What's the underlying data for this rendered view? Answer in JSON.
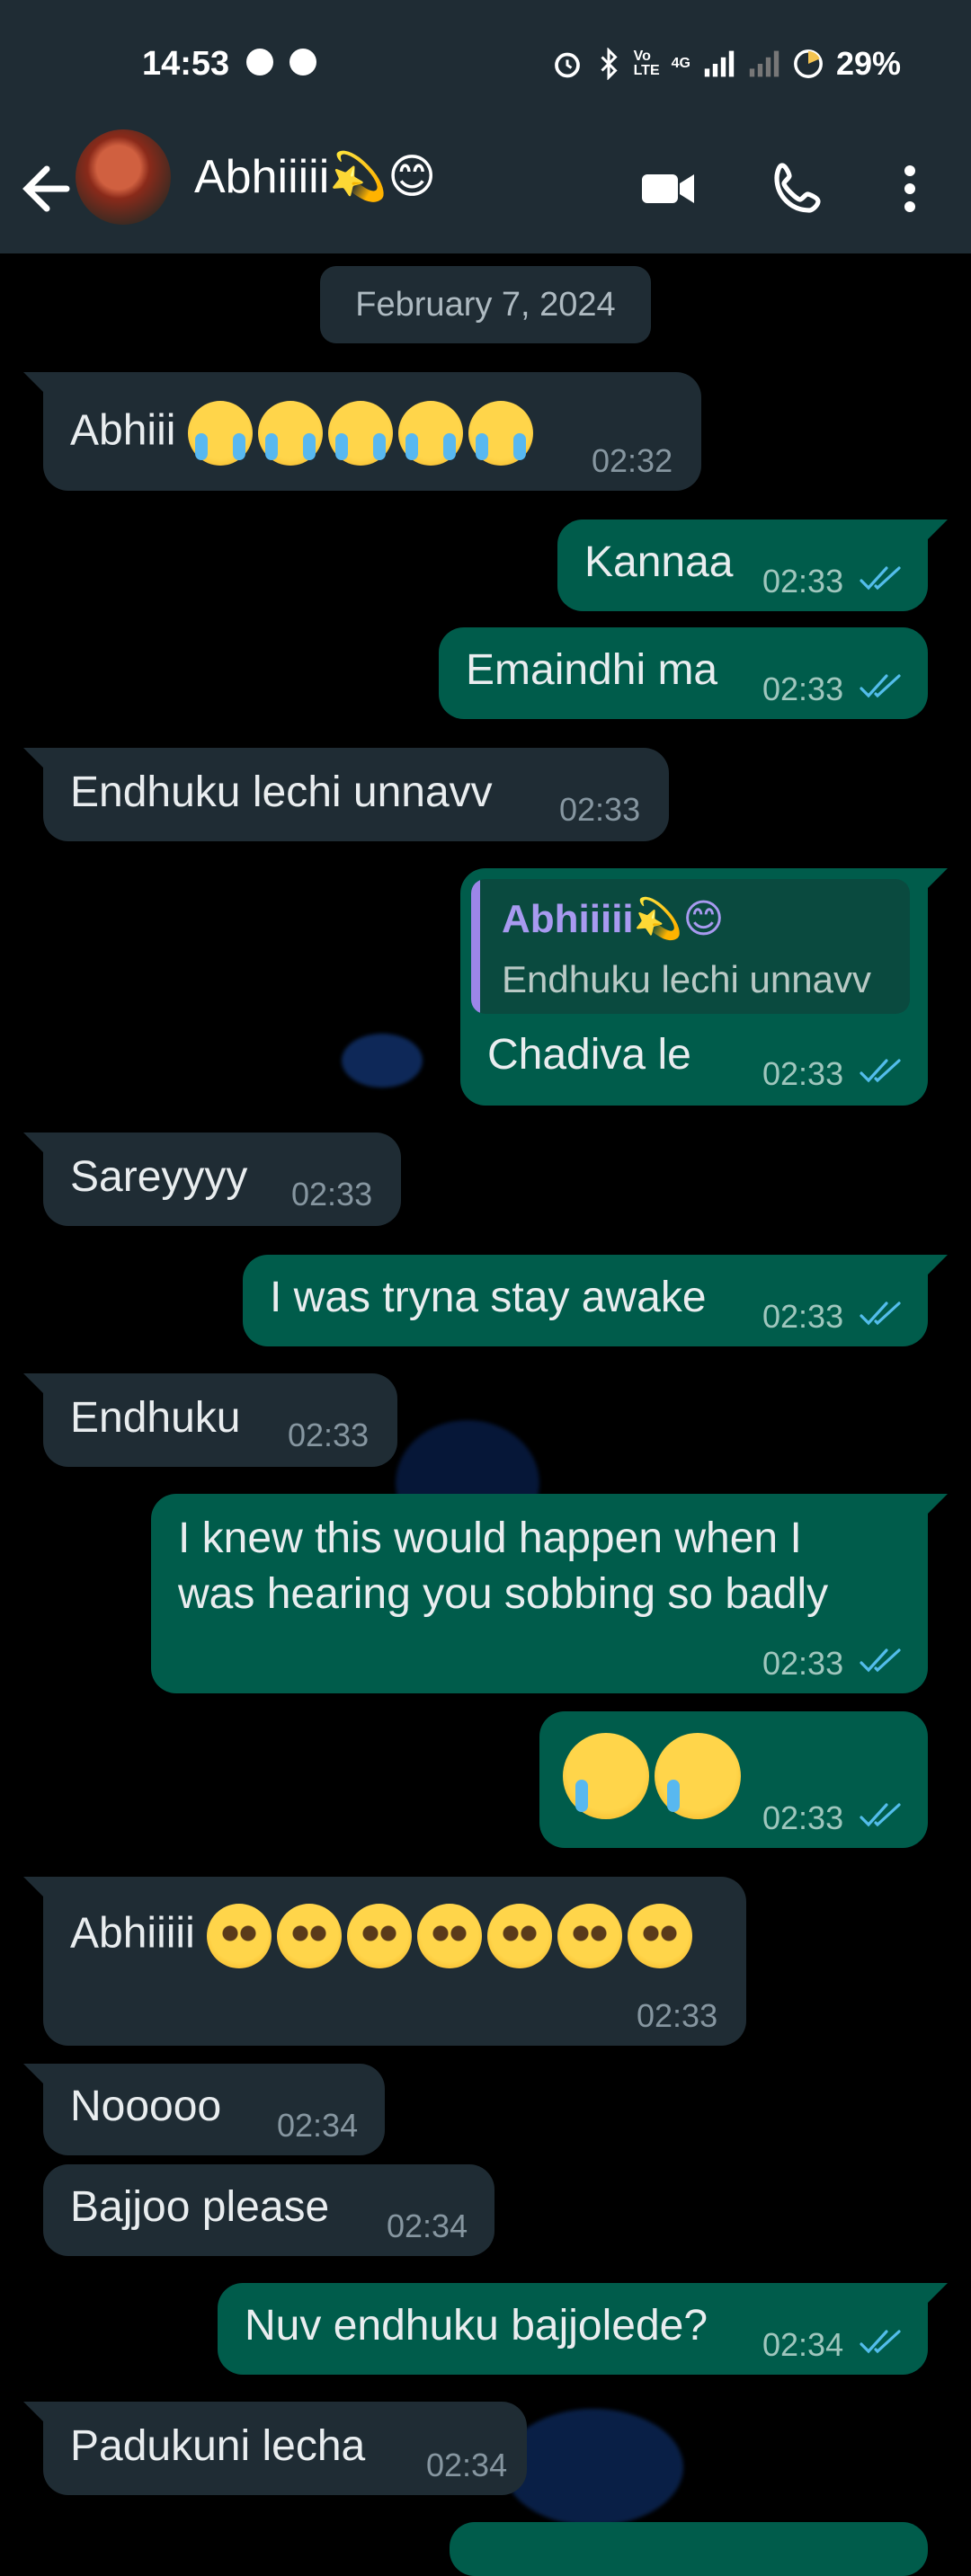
{
  "status_bar": {
    "time": "14:53",
    "battery": "29%",
    "network": "4G",
    "volte": "Vo LTE",
    "icons": [
      "whatsapp-icon",
      "messenger-icon",
      "alarm-icon",
      "bluetooth-icon",
      "volte-icon",
      "signal-icon",
      "signal-2-icon",
      "battery-icon"
    ]
  },
  "header": {
    "contact_name": "Abhiiiii",
    "name_emoji": "💫😊",
    "icons": [
      "back-arrow-icon",
      "video-call-icon",
      "voice-call-icon",
      "more-options-icon"
    ]
  },
  "date_label": "February 7, 2024",
  "messages": [
    {
      "dir": "in",
      "text": "Abhiii",
      "emoji": "😭😭😭😭😭",
      "time": "02:32"
    },
    {
      "dir": "out",
      "text": "Kannaa",
      "time": "02:33"
    },
    {
      "dir": "out",
      "text": "Emaindhi ma",
      "time": "02:33"
    },
    {
      "dir": "in",
      "text": "Endhuku lechi unnavv",
      "time": "02:33"
    },
    {
      "dir": "out",
      "text": "Chadiva le",
      "time": "02:33",
      "quote": {
        "name": "Abhiiiii💫😊",
        "text": "Endhuku lechi unnavv"
      }
    },
    {
      "dir": "in",
      "text": "Sareyyyy",
      "time": "02:33"
    },
    {
      "dir": "out",
      "text": "I was tryna stay awake",
      "time": "02:33"
    },
    {
      "dir": "in",
      "text": "Endhuku",
      "time": "02:33"
    },
    {
      "dir": "out",
      "line1": "I knew this would happen when I",
      "line2": "was hearing you sobbing so badly",
      "time": "02:33"
    },
    {
      "dir": "out",
      "emoji": "🥲🥲",
      "time": "02:33"
    },
    {
      "dir": "in",
      "text": "Abhiiiii",
      "emoji": "🥺🥺🥺🥺🥺🥺🥺",
      "time": "02:33"
    },
    {
      "dir": "in",
      "text": "Nooooo",
      "time": "02:34"
    },
    {
      "dir": "in",
      "text": "Bajjoo please",
      "time": "02:34"
    },
    {
      "dir": "out",
      "text": "Nuv endhuku bajjolede?",
      "time": "02:34"
    },
    {
      "dir": "in",
      "text": "Padukuni lecha",
      "time": "02:34"
    }
  ],
  "colors": {
    "header_bg": "#1f2c34",
    "incoming_bubble": "#1f2c34",
    "outgoing_bubble": "#005c4b",
    "read_ticks": "#53bdeb",
    "quote_accent": "#9c86e8"
  }
}
